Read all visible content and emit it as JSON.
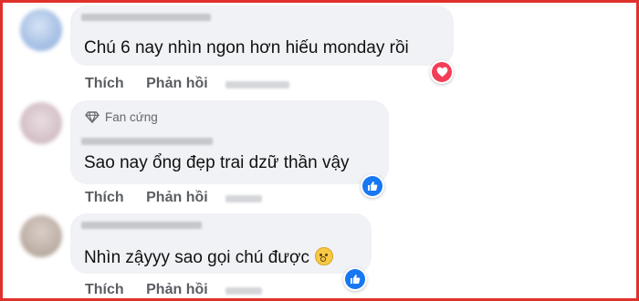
{
  "comments": [
    {
      "text": "Chú 6 nay nhìn ngon hơn hiếu monday rồi",
      "reaction": "love-heart",
      "badge": null
    },
    {
      "text": "Sao nay ổng đẹp trai dzữ thần vậy",
      "reaction": "like-thumb",
      "badge": "Fan cứng"
    },
    {
      "text": "Nhìn zậyyy sao gọi chú được",
      "reaction": "like-thumb",
      "badge": null,
      "emoji": "hushed-face"
    }
  ],
  "actions": {
    "like": "Thích",
    "reply": "Phản hồi"
  },
  "colors": {
    "frame": "#e0302b",
    "bubble": "#f0f2f5",
    "like_blue": "#1877f2",
    "love_red": "#f33e58",
    "action_text": "#5a5d62"
  }
}
